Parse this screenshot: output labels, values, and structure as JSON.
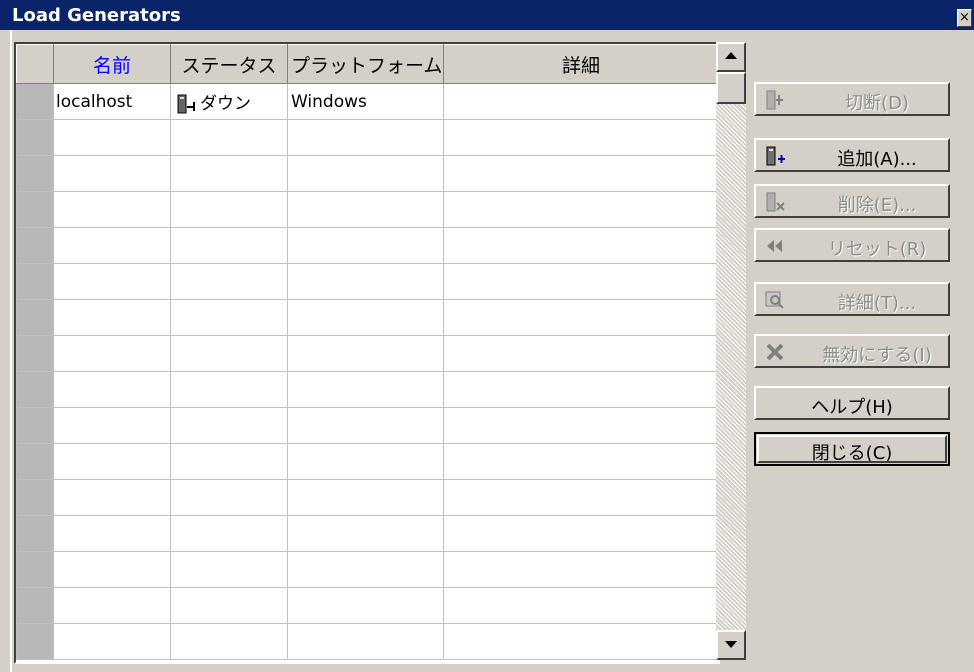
{
  "window": {
    "title": "Load Generators",
    "close_glyph": "×"
  },
  "grid": {
    "columns": [
      "名前",
      "ステータス",
      "プラットフォーム",
      "詳細"
    ],
    "rows": [
      {
        "name": "localhost",
        "status": "ダウン",
        "platform": "Windows",
        "details": ""
      }
    ],
    "empty_rows": 15,
    "accent_header_color": "#0000ff"
  },
  "buttons": {
    "disconnect": {
      "label": "切断(D)",
      "icon": "server-disconnect-icon",
      "enabled": false
    },
    "add": {
      "label": "追加(A)...",
      "icon": "server-add-icon",
      "enabled": true
    },
    "delete": {
      "label": "削除(E)...",
      "icon": "server-delete-icon",
      "enabled": false
    },
    "reset": {
      "label": "リセット(R)",
      "icon": "rewind-icon",
      "enabled": false
    },
    "details": {
      "label": "詳細(T)...",
      "icon": "magnifier-icon",
      "enabled": false
    },
    "disable": {
      "label": "無効にする(I)",
      "icon": "x-icon",
      "enabled": false
    },
    "help": {
      "label": "ヘルプ(H)",
      "enabled": true
    },
    "close": {
      "label": "閉じる(C)",
      "enabled": true
    }
  }
}
